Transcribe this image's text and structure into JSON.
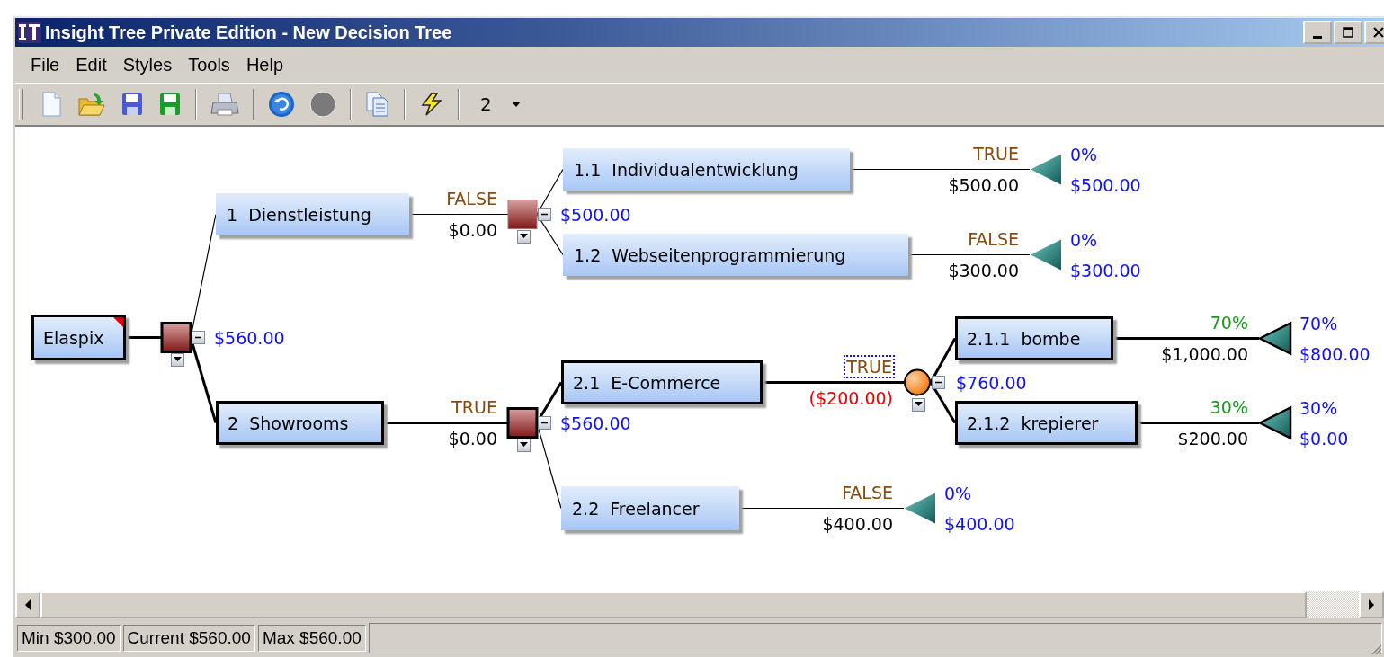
{
  "window": {
    "title": "Insight Tree Private Edition - New Decision Tree"
  },
  "menu": [
    "File",
    "Edit",
    "Styles",
    "Tools",
    "Help"
  ],
  "toolbar": {
    "level_selector": "2"
  },
  "tree": {
    "label": "Elaspix",
    "optimal": true,
    "has_note": true,
    "node": {
      "kind": "decision",
      "expanded": true,
      "value": "$560.00"
    },
    "children": [
      {
        "label": "1  Dienstleistung",
        "optimal": false,
        "condition": "FALSE",
        "focused": false,
        "cost": "$0.00",
        "cost_negative": false,
        "node": {
          "kind": "decision",
          "expanded": true,
          "value": "$500.00"
        },
        "children": [
          {
            "label": "1.1  Individualentwicklung",
            "optimal": false,
            "condition": "TRUE",
            "focused": false,
            "cost": "$500.00",
            "cost_negative": false,
            "node": {
              "kind": "terminal",
              "probability": "0%",
              "value": "$500.00"
            }
          },
          {
            "label": "1.2  Webseitenprogrammierung",
            "optimal": false,
            "condition": "FALSE",
            "focused": false,
            "cost": "$300.00",
            "cost_negative": false,
            "node": {
              "kind": "terminal",
              "probability": "0%",
              "value": "$300.00"
            }
          }
        ]
      },
      {
        "label": "2  Showrooms",
        "optimal": true,
        "condition": "TRUE",
        "focused": false,
        "cost": "$0.00",
        "cost_negative": false,
        "node": {
          "kind": "decision",
          "expanded": true,
          "value": "$560.00"
        },
        "children": [
          {
            "label": "2.1  E-Commerce",
            "optimal": true,
            "condition": "TRUE",
            "focused": true,
            "cost": "($200.00)",
            "cost_negative": true,
            "node": {
              "kind": "chance",
              "expanded": true,
              "value": "$760.00"
            },
            "children": [
              {
                "label": "2.1.1  bombe",
                "optimal": true,
                "condition": "70%",
                "focused": false,
                "cost": "$1,000.00",
                "cost_negative": false,
                "node": {
                  "kind": "terminal",
                  "probability": "70%",
                  "value": "$800.00"
                }
              },
              {
                "label": "2.1.2  krepierer",
                "optimal": true,
                "condition": "30%",
                "focused": false,
                "cost": "$200.00",
                "cost_negative": false,
                "node": {
                  "kind": "terminal",
                  "probability": "30%",
                  "value": "$0.00"
                }
              }
            ]
          },
          {
            "label": "2.2  Freelancer",
            "optimal": false,
            "condition": "FALSE",
            "focused": false,
            "cost": "$400.00",
            "cost_negative": false,
            "node": {
              "kind": "terminal",
              "probability": "0%",
              "value": "$400.00"
            }
          }
        ]
      }
    ]
  },
  "status_bar": [
    "Min $300.00",
    "Current $560.00",
    "Max $560.00"
  ]
}
